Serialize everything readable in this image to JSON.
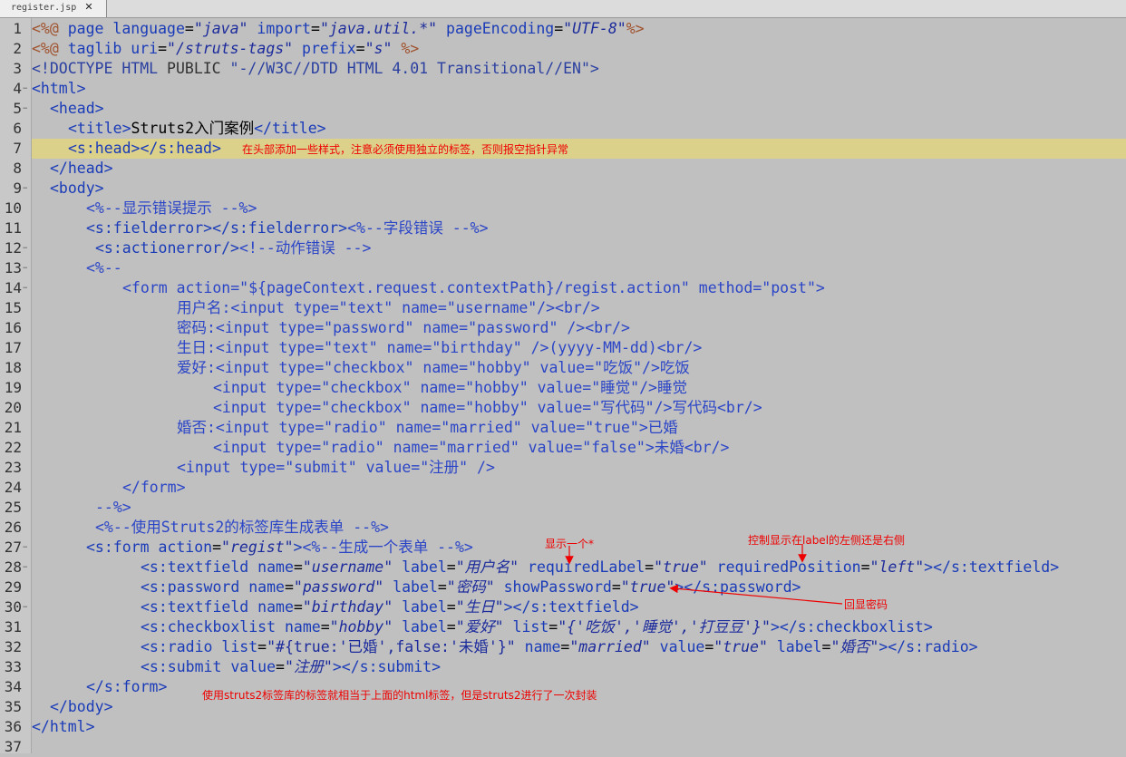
{
  "tab": {
    "label": "register.jsp",
    "close": "✕"
  },
  "lines": [
    {
      "n": "1"
    },
    {
      "n": "2"
    },
    {
      "n": "3"
    },
    {
      "n": "4"
    },
    {
      "n": "5"
    },
    {
      "n": "6"
    },
    {
      "n": "7"
    },
    {
      "n": "8"
    },
    {
      "n": "9"
    },
    {
      "n": "10"
    },
    {
      "n": "11"
    },
    {
      "n": "12"
    },
    {
      "n": "13"
    },
    {
      "n": "14"
    },
    {
      "n": "15"
    },
    {
      "n": "16"
    },
    {
      "n": "17"
    },
    {
      "n": "18"
    },
    {
      "n": "19"
    },
    {
      "n": "20"
    },
    {
      "n": "21"
    },
    {
      "n": "22"
    },
    {
      "n": "23"
    },
    {
      "n": "24"
    },
    {
      "n": "25"
    },
    {
      "n": "26"
    },
    {
      "n": "27"
    },
    {
      "n": "28"
    },
    {
      "n": "29"
    },
    {
      "n": "30"
    },
    {
      "n": "31"
    },
    {
      "n": "32"
    },
    {
      "n": "33"
    },
    {
      "n": "34"
    },
    {
      "n": "35"
    },
    {
      "n": "36"
    },
    {
      "n": "37"
    }
  ],
  "code": {
    "l1": [
      "<%@ ",
      "page ",
      "language",
      "=",
      "\"java\"",
      " import",
      "=",
      "\"java.util.*\"",
      " pageEncoding",
      "=",
      "\"UTF-8\"",
      "%>"
    ],
    "l2": [
      "<%@ ",
      "taglib ",
      "uri",
      "=",
      "\"/struts-tags\"",
      " prefix",
      "=",
      "\"s\"",
      " %>"
    ],
    "l3": [
      "<!DOCTYPE HTML ",
      "PUBLIC",
      " \"-//W3C//DTD HTML 4.01 Transitional//EN\">"
    ],
    "l4": "<html>",
    "l5": "<head>",
    "l6": [
      "<title>",
      "Struts2入门案例",
      "</title>"
    ],
    "l7": "<s:head></s:head>",
    "l8": "</head>",
    "l9": "<body>",
    "l10": "<%--显示错误提示 --%>",
    "l11": [
      "<s:fielderror></s:fielderror>",
      "<%--字段错误 --%>"
    ],
    "l12": [
      "<s:actionerror/>",
      "<!--动作错误 -->"
    ],
    "l13": "<%--",
    "l14": "<form action=\"${pageContext.request.contextPath}/regist.action\" method=\"post\">",
    "l15": "用户名:<input type=\"text\" name=\"username\"/><br/>",
    "l16": "密码:<input type=\"password\" name=\"password\" /><br/>",
    "l17": "生日:<input type=\"text\" name=\"birthday\" />(yyyy-MM-dd)<br/>",
    "l18": "爱好:<input type=\"checkbox\" name=\"hobby\" value=\"吃饭\"/>吃饭",
    "l19": "<input type=\"checkbox\" name=\"hobby\" value=\"睡觉\"/>睡觉",
    "l20": "<input type=\"checkbox\" name=\"hobby\" value=\"写代码\"/>写代码<br/>",
    "l21": "婚否:<input type=\"radio\" name=\"married\" value=\"true\">已婚",
    "l22": "<input type=\"radio\" name=\"married\" value=\"false\">未婚<br/>",
    "l23": "<input type=\"submit\" value=\"注册\" />",
    "l24": "</form>",
    "l25": "--%>",
    "l26": "<%--使用Struts2的标签库生成表单 --%>",
    "l27": [
      "<s:form ",
      "action",
      "=",
      "\"regist\"",
      ">",
      "<%--生成一个表单 --%>"
    ],
    "l28": [
      "<s:textfield ",
      "name",
      "=",
      "\"username\"",
      " label",
      "=",
      "\"用户名\"",
      " requiredLabel",
      "=",
      "\"true\"",
      " requiredPosition",
      "=",
      "\"left\"",
      "></s:textfield>"
    ],
    "l29": [
      "<s:password ",
      "name",
      "=",
      "\"password\"",
      " label",
      "=",
      "\"密码\"",
      " showPassword",
      "=",
      "\"true\"",
      "></s:password>"
    ],
    "l30": [
      "<s:textfield ",
      "name",
      "=",
      "\"birthday\"",
      " label",
      "=",
      "\"生日\"",
      "></s:textfield>"
    ],
    "l31": [
      "<s:checkboxlist ",
      "name",
      "=",
      "\"hobby\"",
      " label",
      "=",
      "\"爱好\"",
      " list",
      "=",
      "\"{'吃饭','睡觉','打豆豆'}\"",
      "></s:checkboxlist>"
    ],
    "l32": [
      "<s:radio ",
      "list",
      "=",
      "\"#{true:'已婚',false:'未婚'}\"",
      " name",
      "=",
      "\"married\"",
      " value",
      "=",
      "\"true\"",
      " label",
      "=",
      "\"婚否\"",
      "></s:radio>"
    ],
    "l33": [
      "<s:submit ",
      "value",
      "=",
      "\"注册\"",
      "></s:submit>"
    ],
    "l34": "</s:form>",
    "l35": "</body>",
    "l36": "</html>"
  },
  "annotations": {
    "a1": "在头部添加一些样式，注意必须使用独立的标签，否则报空指针异常",
    "a2": "显示一个*",
    "a3": "控制显示在label的左侧还是右侧",
    "a4": "回显密码",
    "a5": "使用struts2标签库的标签就相当于上面的html标签，但是struts2进行了一次封装"
  },
  "colors": {
    "highlight": "#dcd18a",
    "annotation": "#e00000",
    "background": "#c0c0c0"
  }
}
